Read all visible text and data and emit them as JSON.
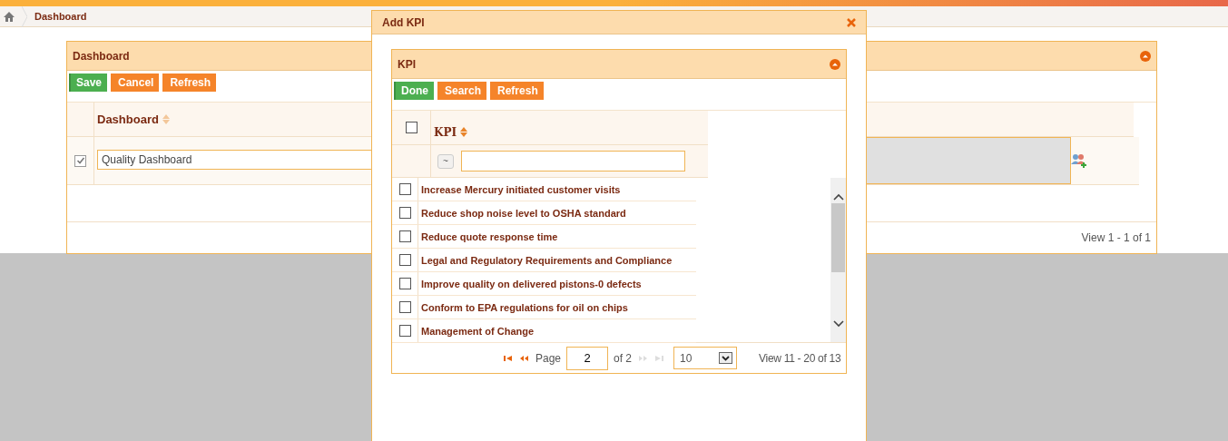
{
  "breadcrumb": {
    "label": "Dashboard"
  },
  "panel": {
    "title": "Dashboard",
    "buttons": [
      {
        "label": "Save",
        "kind": "primary"
      },
      {
        "label": "Cancel",
        "kind": "secondary"
      },
      {
        "label": "Refresh",
        "kind": "secondary"
      }
    ],
    "column": "Dashboard",
    "rows": [
      {
        "checked": true,
        "value": "Quality Dashboard"
      }
    ],
    "footer": "View 1 - 1 of 1"
  },
  "dialog": {
    "title": "Add KPI",
    "panel": {
      "title": "KPI",
      "buttons": [
        {
          "label": "Done",
          "kind": "primary"
        },
        {
          "label": "Search",
          "kind": "secondary"
        },
        {
          "label": "Refresh",
          "kind": "secondary"
        }
      ],
      "select_all": {
        "checked": false
      },
      "column": "KPI",
      "filter_operator": "~",
      "rows": [
        {
          "label": "Increase Mercury initiated customer visits",
          "checked": false
        },
        {
          "label": "Reduce shop noise level to OSHA standard",
          "checked": false
        },
        {
          "label": "Reduce quote response time",
          "checked": false
        },
        {
          "label": "Legal and Regulatory Requirements and Compliance",
          "checked": false
        },
        {
          "label": "Improve quality on delivered pistons-0 defects",
          "checked": false
        },
        {
          "label": "Conform to EPA regulations for oil on chips",
          "checked": false
        },
        {
          "label": "Management of Change",
          "checked": false
        }
      ],
      "pager": {
        "back_disabled": false,
        "forward_disabled": true,
        "page_label": "Page",
        "page": "2",
        "of": "of 2",
        "page_size": "10",
        "view": "View 11 - 20 of 13"
      }
    }
  }
}
